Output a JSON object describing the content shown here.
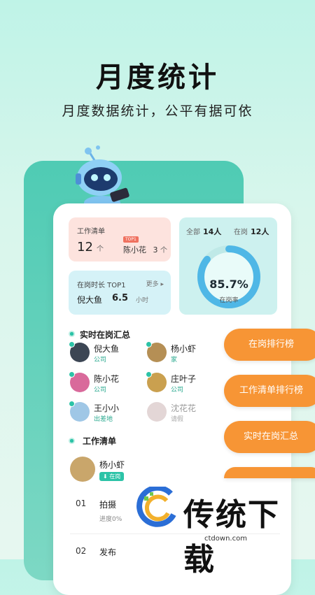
{
  "hero": {
    "title": "月度统计",
    "subtitle": "月度数据统计，公平有据可依"
  },
  "work_card": {
    "label": "工作清单",
    "count": "12",
    "unit": "个",
    "badge": "TOP1",
    "top_name": "陈小花",
    "top_count": "3",
    "top_unit": "个"
  },
  "online_card": {
    "label": "在岗时长 TOP1",
    "more": "更多",
    "name": "倪大鱼",
    "value": "6.5",
    "unit": "小时"
  },
  "stats_card": {
    "all_label": "全部",
    "all_value": "14人",
    "on_label": "在岗",
    "on_value": "12人",
    "rate": "85.7%",
    "rate_label": "在岗率",
    "rate_value": 0.857
  },
  "section_realtime": {
    "title": "实时在岗汇总"
  },
  "people": [
    {
      "name": "倪大鱼",
      "status": "公司"
    },
    {
      "name": "杨小虾",
      "status": "家"
    },
    {
      "name": "陈小花",
      "status": "公司"
    },
    {
      "name": "庄叶子",
      "status": "公司"
    },
    {
      "name": "王小小",
      "status": "出差地"
    },
    {
      "name": "沈花花",
      "status": "请假"
    }
  ],
  "section_work": {
    "title": "工作清单"
  },
  "work_item": {
    "user": "杨小虾",
    "tag": "在岗",
    "tasks": [
      {
        "no": "01",
        "name": "拍摄",
        "progress": "进度0%"
      },
      {
        "no": "02",
        "name": "发布"
      }
    ]
  },
  "pills": [
    "在岗排行榜",
    "工作清单排行榜",
    "实时在岗汇总"
  ],
  "watermark": {
    "text": "传统下载",
    "domain": "ctdown.com"
  },
  "colors": {
    "accent": "#2cc3a7",
    "orange": "#f79535",
    "panel": "#4fcbb4"
  }
}
